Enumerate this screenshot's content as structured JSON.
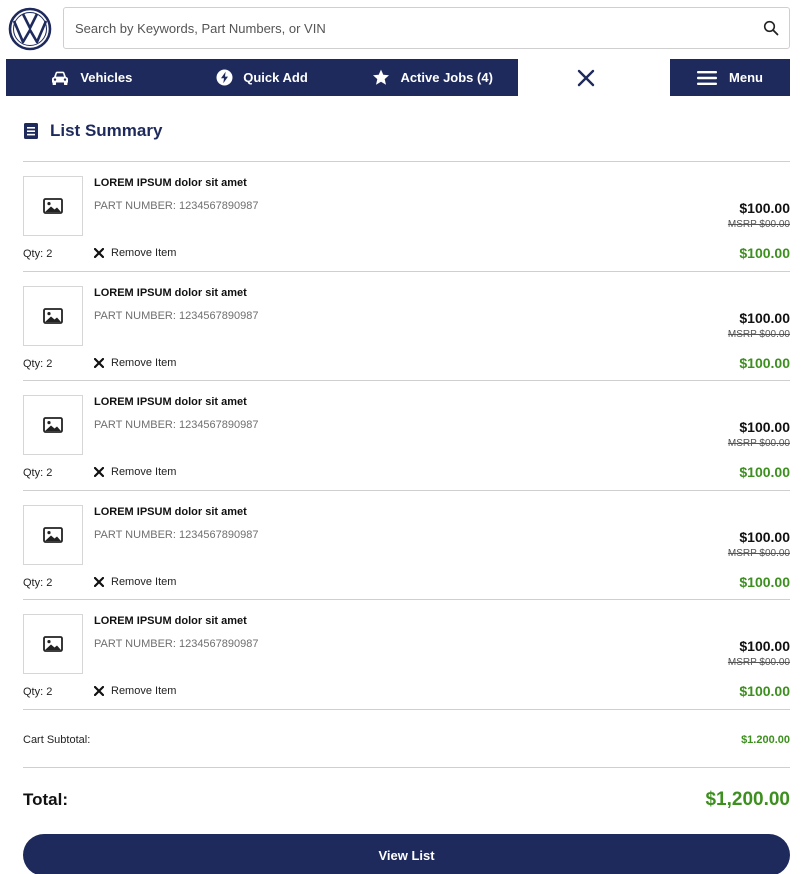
{
  "search": {
    "placeholder": "Search by Keywords, Part Numbers, or VIN"
  },
  "nav": {
    "items": [
      {
        "label": "Vehicles",
        "icon": "car-icon"
      },
      {
        "label": "Quick Add",
        "icon": "bolt-icon"
      },
      {
        "label": "Active Jobs (4)",
        "icon": "star-icon"
      }
    ],
    "menu_label": "Menu"
  },
  "summary": {
    "title": "List Summary"
  },
  "items": [
    {
      "name": "LOREM IPSUM dolor sit amet",
      "part": "PART NUMBER: 1234567890987",
      "price": "$100.00",
      "msrp": "MSRP $00.00",
      "qty": "Qty: 2",
      "remove": "Remove Item",
      "total": "$100.00"
    },
    {
      "name": "LOREM IPSUM dolor sit amet",
      "part": "PART NUMBER: 1234567890987",
      "price": "$100.00",
      "msrp": "MSRP $00.00",
      "qty": "Qty: 2",
      "remove": "Remove Item",
      "total": "$100.00"
    },
    {
      "name": "LOREM IPSUM dolor sit amet",
      "part": "PART NUMBER: 1234567890987",
      "price": "$100.00",
      "msrp": "MSRP $00.00",
      "qty": "Qty: 2",
      "remove": "Remove Item",
      "total": "$100.00"
    },
    {
      "name": "LOREM IPSUM dolor sit amet",
      "part": "PART NUMBER: 1234567890987",
      "price": "$100.00",
      "msrp": "MSRP $00.00",
      "qty": "Qty: 2",
      "remove": "Remove Item",
      "total": "$100.00"
    },
    {
      "name": "LOREM IPSUM dolor sit amet",
      "part": "PART NUMBER: 1234567890987",
      "price": "$100.00",
      "msrp": "MSRP $00.00",
      "qty": "Qty: 2",
      "remove": "Remove Item",
      "total": "$100.00"
    }
  ],
  "cart": {
    "subtotal_label": "Cart Subtotal:",
    "subtotal_value": "$1.200.00"
  },
  "total": {
    "label": "Total:",
    "value": "$1,200.00"
  },
  "actions": {
    "view_list_label": "View List"
  },
  "colors": {
    "navy": "#1e2a5c",
    "price_green": "#3d8f1f"
  }
}
